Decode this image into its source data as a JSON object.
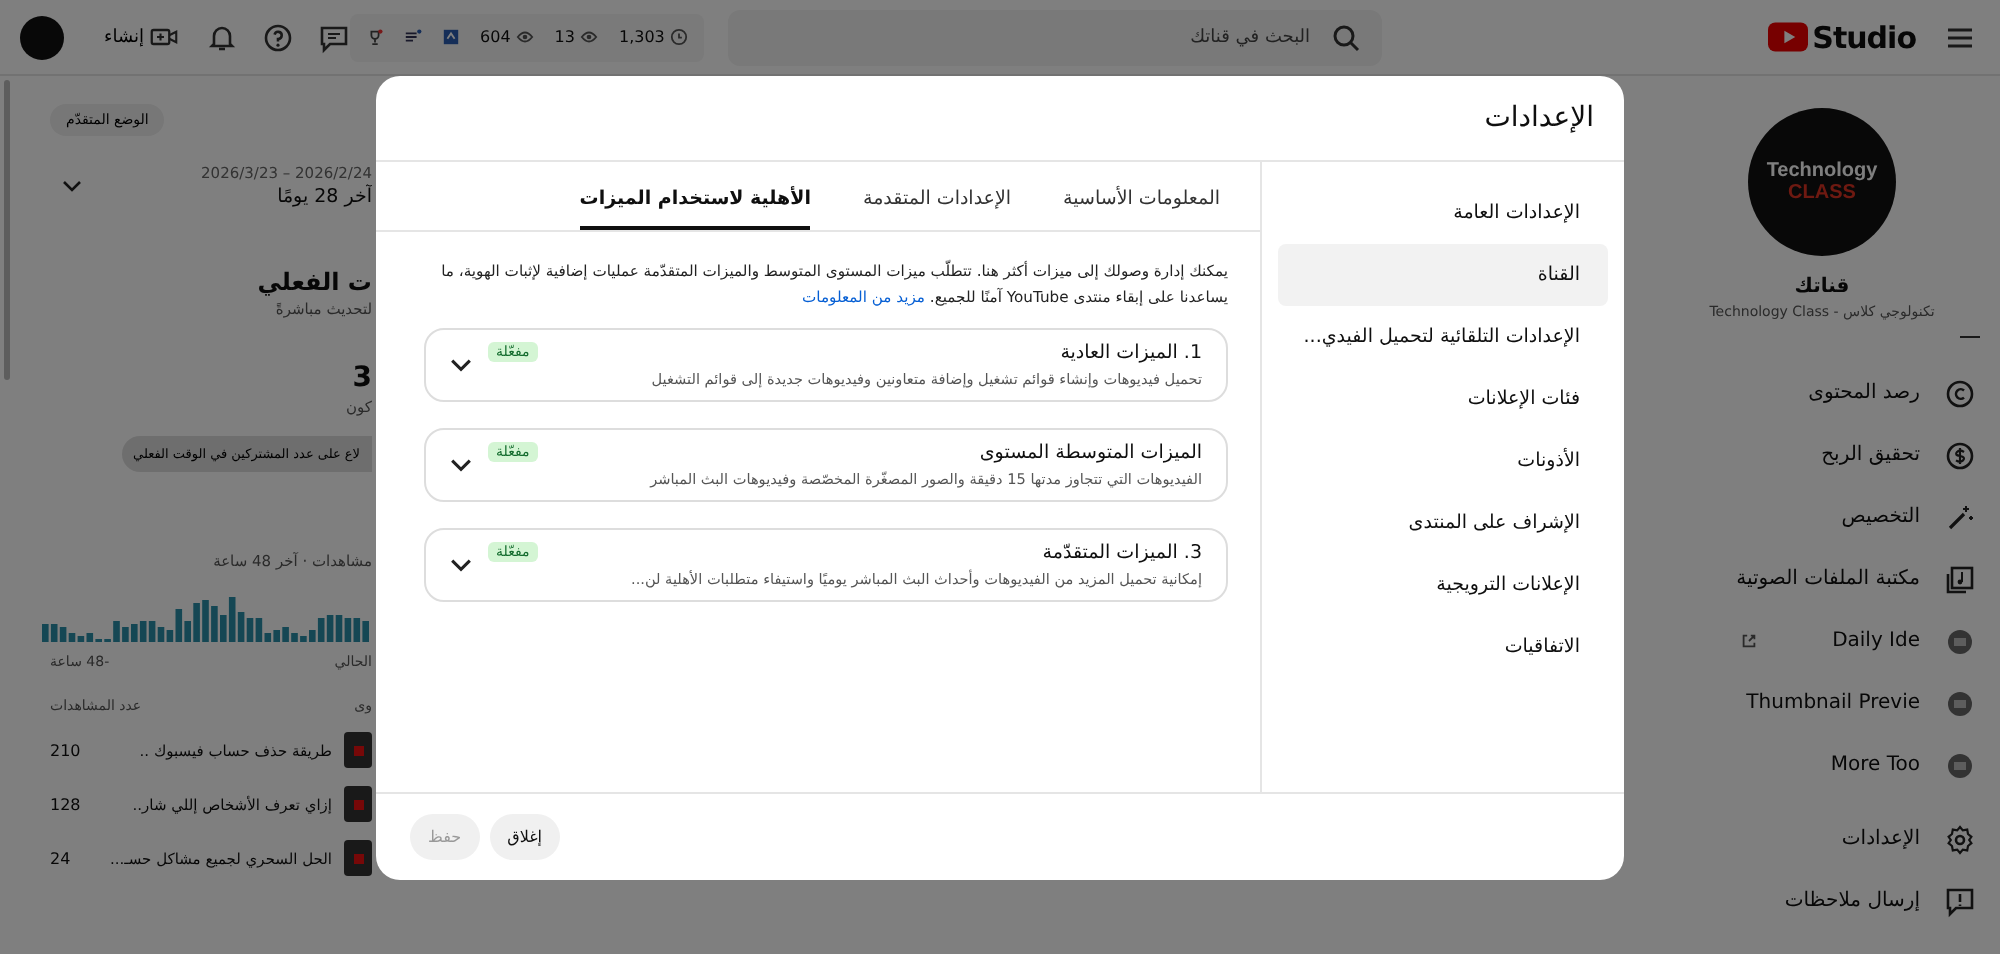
{
  "topbar": {
    "logo_text": "Studio",
    "search": {
      "placeholder": "البحث في قناتك"
    },
    "stats": [
      {
        "value": "1,303",
        "kind": "clock"
      },
      {
        "value": "13",
        "kind": "eye"
      },
      {
        "value": "604",
        "kind": "eye"
      }
    ],
    "create_button": "إنشاء"
  },
  "sidebar": {
    "channel_logo": {
      "line_1": "Technology",
      "line_2": "CLASS"
    },
    "channel_label": "قناتك",
    "channel_name": "تكنولوجي كلاس - Technology Class",
    "items": [
      {
        "label": "رصد المحتوى",
        "kind": "copyright",
        "external": false
      },
      {
        "label": "تحقيق الربح",
        "kind": "dollar",
        "external": false
      },
      {
        "label": "التخصيص",
        "kind": "wand",
        "external": false
      },
      {
        "label": "مكتبة الملفات الصوتية",
        "kind": "music",
        "external": false
      },
      {
        "label": "Daily Ide",
        "kind": "app",
        "external": true
      },
      {
        "label": "Thumbnail Previe",
        "kind": "app",
        "external": false
      },
      {
        "label": "More Too",
        "kind": "app",
        "external": false
      }
    ],
    "bottom_items": [
      {
        "label": "الإعدادات",
        "kind": "gear"
      },
      {
        "label": "إرسال ملاحظات",
        "kind": "feedback"
      }
    ]
  },
  "dashboard": {
    "advanced_mode_button": "الوضع المتقدّم",
    "date_range": "2026/2/24 – 2026/3/23",
    "period": "آخر 28 يومًا",
    "realtime_title": "ت الفعلي",
    "realtime_subtitle": "لتحديث مباشرةً",
    "subscribers_value": "3",
    "subscribers_label": "كون",
    "realtime_button": "لاع على عدد المشتركين في الوقت الفعلي",
    "views_caption": "مشاهدات · آخر 48 ساعة",
    "axis_now": "الحالي",
    "axis_start": "-48 ساعة",
    "column_1": "وى",
    "column_2": "عدد المشاهدات",
    "videos": [
      {
        "title": "طريقة حذف حساب فيسبوك ..",
        "views": "210"
      },
      {
        "title": "إزاي تعرف الأشخاص إللي شار..",
        "views": "128"
      },
      {
        "title": "الحل السحري لجميع مشاكل حسـ...",
        "views": "24"
      }
    ]
  },
  "modal": {
    "title": "الإعدادات",
    "nav": [
      {
        "label": "الإعدادات العامة",
        "selected": false
      },
      {
        "label": "القناة",
        "selected": true
      },
      {
        "label": "الإعدادات التلقائية لتحميل الفيدي...",
        "selected": false
      },
      {
        "label": "فئات الإعلانات",
        "selected": false
      },
      {
        "label": "الأذونات",
        "selected": false
      },
      {
        "label": "الإشراف على المنتدى",
        "selected": false
      },
      {
        "label": "الإعلانات الترويجية",
        "selected": false
      },
      {
        "label": "الاتفاقيات",
        "selected": false
      }
    ],
    "tabs": [
      {
        "label": "المعلومات الأساسية",
        "selected": false
      },
      {
        "label": "الإعدادات المتقدمة",
        "selected": false
      },
      {
        "label": "الأهلية لاستخدام الميزات",
        "selected": true
      }
    ],
    "intro": "يمكنك إدارة وصولك إلى ميزات أكثر هنا. تتطلّب ميزات المستوى المتوسط والميزات المتقدّمة عمليات إضافية لإثبات الهوية، ما يساعدنا على إبقاء منتدى YouTube آمنًا للجميع.",
    "intro_link": "مزيد من المعلومات",
    "features": [
      {
        "title": "1. الميزات العادية",
        "status": "مفعّلة",
        "description": "تحميل فيديوهات وإنشاء قوائم تشغيل وإضافة متعاونين وفيديوهات جديدة إلى قوائم التشغيل",
        "expanded": false
      },
      {
        "title": "الميزات المتوسطة المستوى",
        "status": "مفعّلة",
        "description": "الفيديوهات التي تتجاوز مدتها 15 دقيقة والصور المصغّرة المخصّصة وفيديوهات البث المباشر",
        "expanded": false
      },
      {
        "title": "3. الميزات المتقدّمة",
        "status": "مفعّلة",
        "description": "إمكانية تحميل المزيد من الفيديوهات وأحداث البث المباشر يوميًا واستيفاء متطلبات الأهلية لن...",
        "expanded": false
      }
    ],
    "close_button": "إغلاق",
    "save_button": {
      "label": "حفظ",
      "disabled": true
    }
  }
}
